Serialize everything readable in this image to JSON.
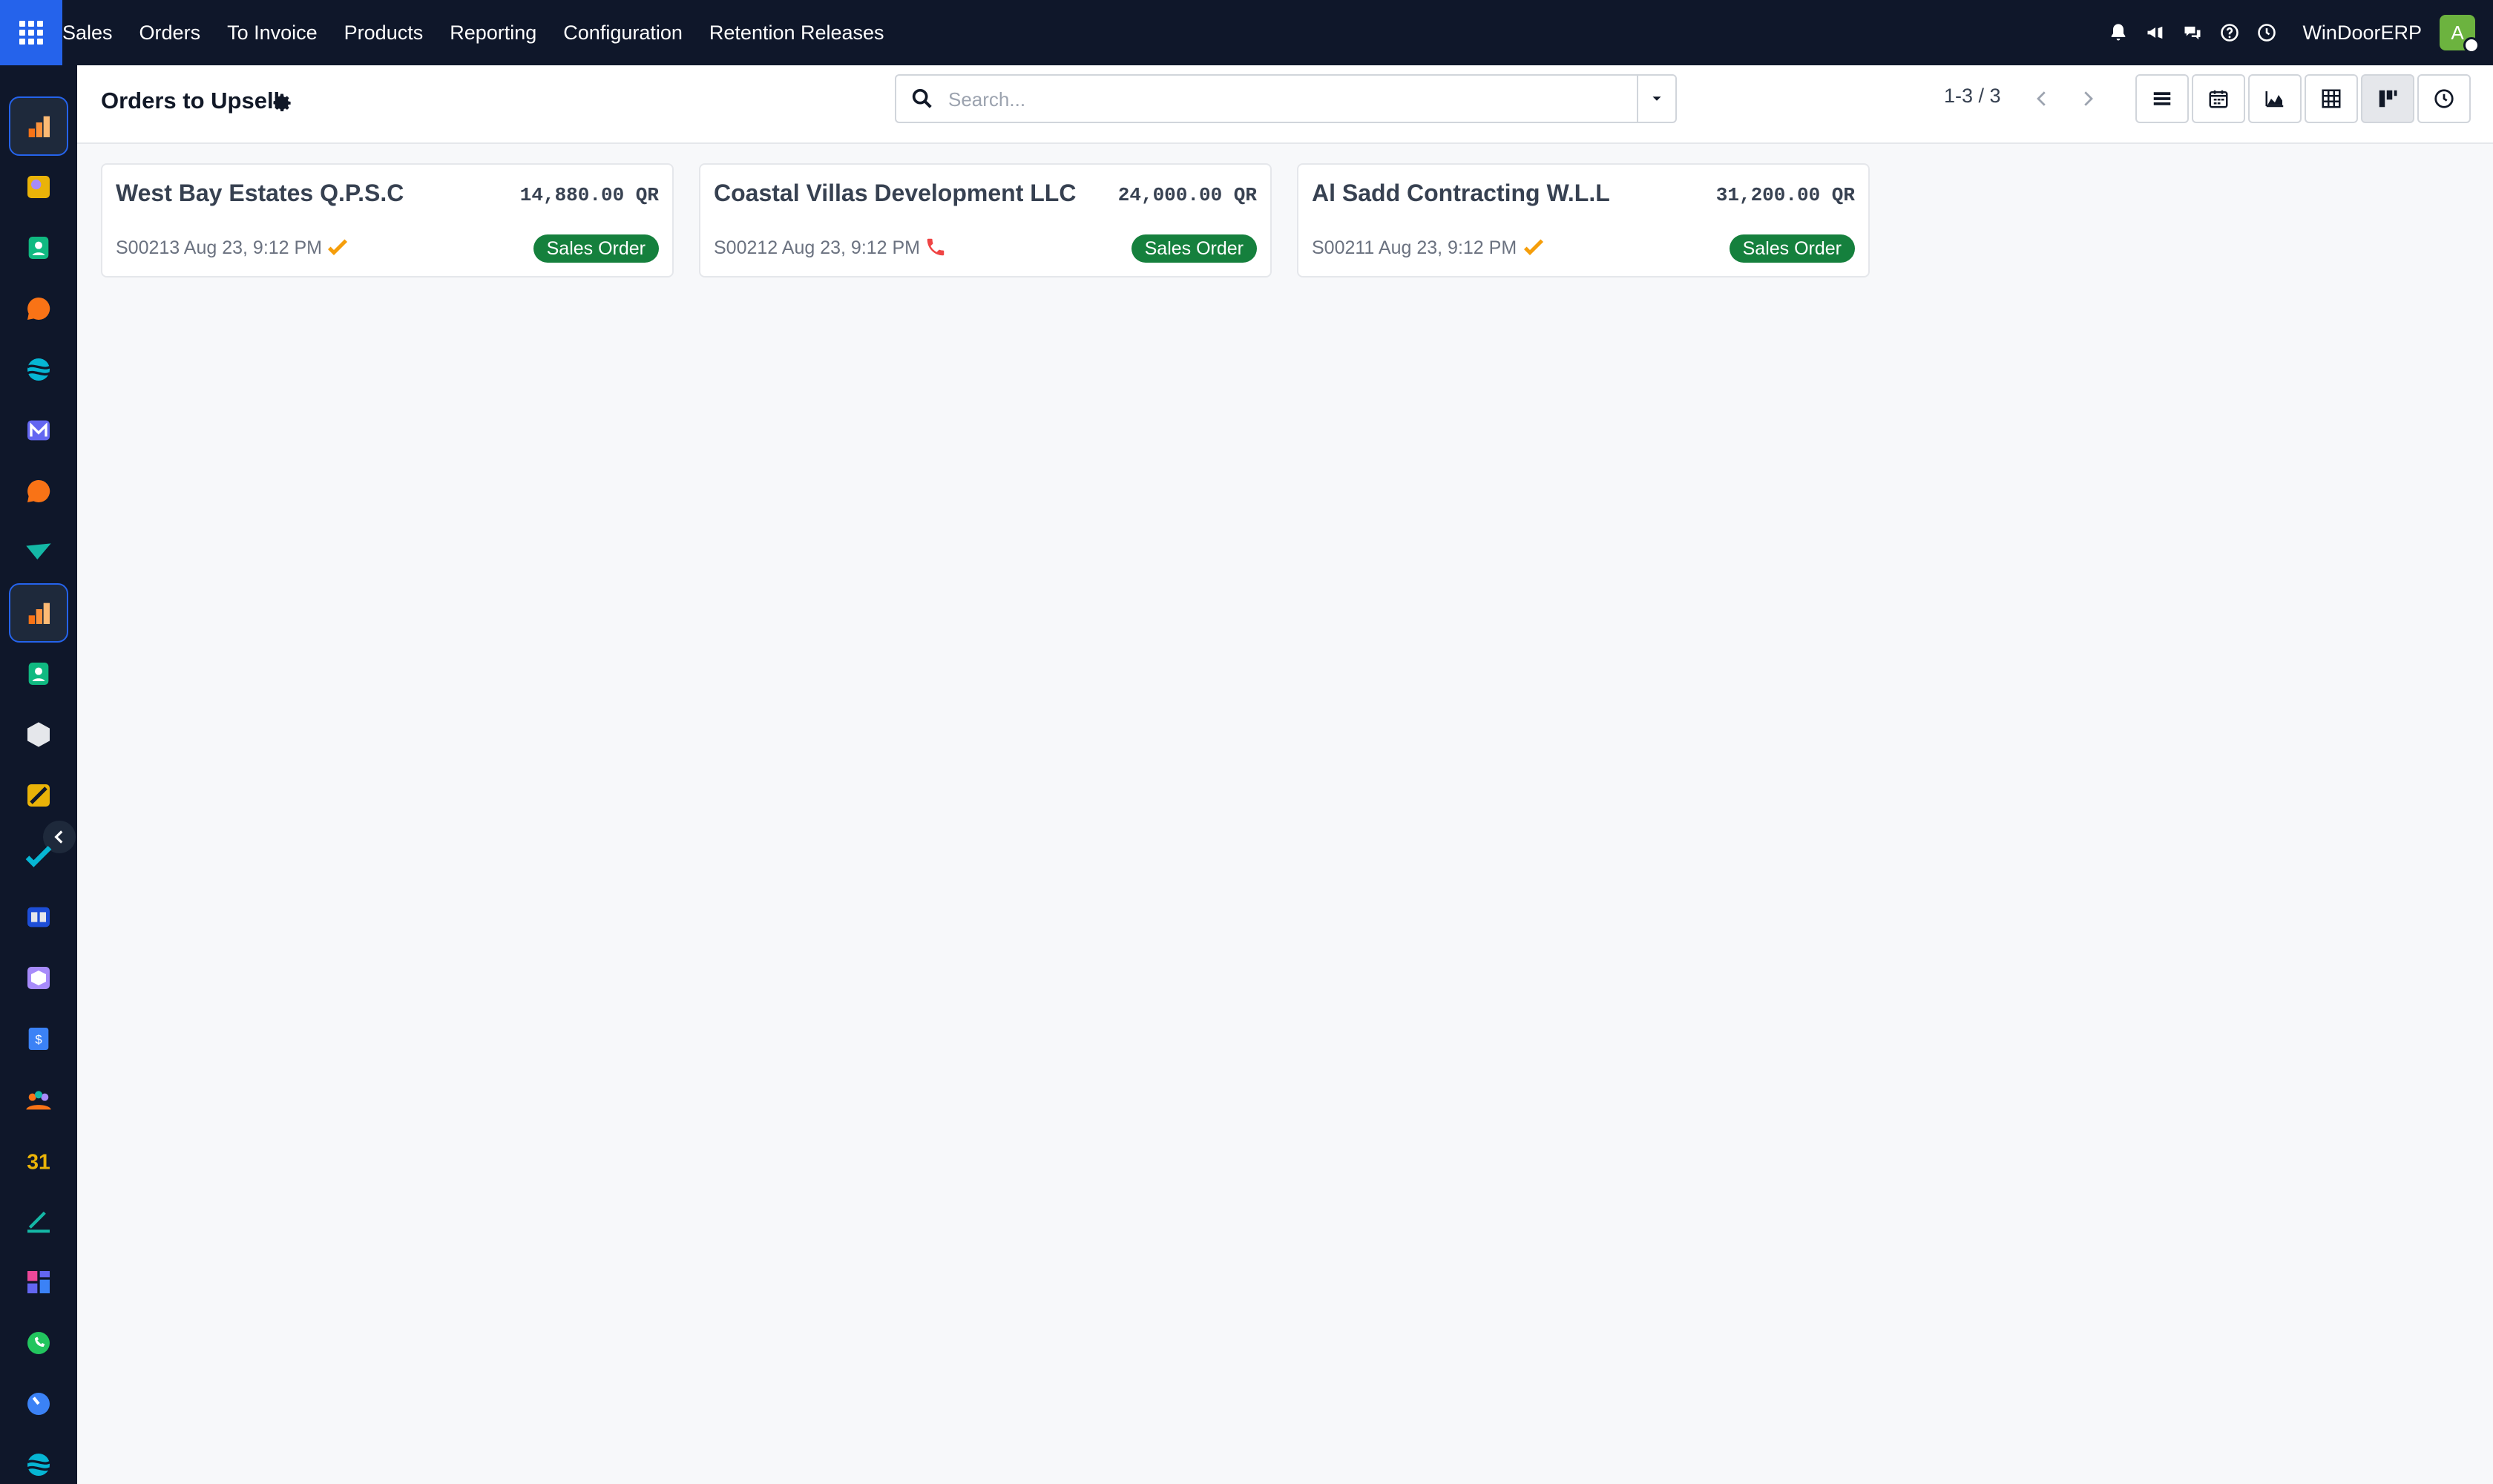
{
  "navbar": {
    "app_name": "Sales",
    "menu_items": [
      "Orders",
      "To Invoice",
      "Products",
      "Reporting",
      "Configuration",
      "Retention Releases"
    ],
    "company": "WinDoorERP",
    "avatar_initial": "A"
  },
  "sidebar": {
    "apps": [
      {
        "icon": "sales-chart-icon",
        "color": "#f97316",
        "active": true
      },
      {
        "icon": "palette-icon",
        "color": "#eab308"
      },
      {
        "icon": "contacts-icon",
        "color": "#10b981"
      },
      {
        "icon": "discuss-icon",
        "color": "#f97316"
      },
      {
        "icon": "website-icon",
        "color": "#06b6d4"
      },
      {
        "icon": "email-marketing-icon",
        "color": "#6366f1"
      },
      {
        "icon": "livechat-icon",
        "color": "#f97316"
      },
      {
        "icon": "crm-icon",
        "color": "#14b8a6"
      },
      {
        "icon": "sales-chart-icon",
        "color": "#f97316",
        "active": true
      },
      {
        "icon": "employees-icon",
        "color": "#10b981"
      },
      {
        "icon": "inventory-icon",
        "color": "#e5e7eb"
      },
      {
        "icon": "studio-icon",
        "color": "#eab308"
      },
      {
        "icon": "project-icon",
        "color": "#06b6d4"
      },
      {
        "icon": "knowledge-icon",
        "color": "#e5e7eb"
      },
      {
        "icon": "purchase-icon",
        "color": "#a78bfa"
      },
      {
        "icon": "invoicing-icon",
        "color": "#3b82f6"
      },
      {
        "icon": "team-icon",
        "color": "#f97316"
      },
      {
        "icon": "calendar-icon",
        "color": "#eab308"
      },
      {
        "icon": "sign-icon",
        "color": "#14b8a6"
      },
      {
        "icon": "dashboard-icon",
        "color": "#ec4899"
      },
      {
        "icon": "whatsapp-icon",
        "color": "#22c55e"
      },
      {
        "icon": "timer-icon",
        "color": "#3b82f6"
      },
      {
        "icon": "website-icon",
        "color": "#06b6d4"
      }
    ]
  },
  "control_panel": {
    "title": "Orders to Upsell",
    "search_placeholder": "Search...",
    "pager": "1-3 / 3"
  },
  "cards": [
    {
      "partner": "West Bay Estates Q.P.S.C",
      "amount": "14,880.00 QR",
      "reference": "S00213",
      "date": "Aug 23, 9:12 PM",
      "activity": "check-icon",
      "status": "Sales Order"
    },
    {
      "partner": "Coastal Villas Development LLC",
      "amount": "24,000.00 QR",
      "reference": "S00212",
      "date": "Aug 23, 9:12 PM",
      "activity": "phone-icon",
      "status": "Sales Order"
    },
    {
      "partner": "Al Sadd Contracting W.L.L",
      "amount": "31,200.00 QR",
      "reference": "S00211",
      "date": "Aug 23, 9:12 PM",
      "activity": "check-icon",
      "status": "Sales Order"
    }
  ],
  "colors": {
    "navbar_bg": "#0f172a",
    "apps_button": "#2563eb",
    "status_badge": "#15803d",
    "activity_check": "#f59e0b",
    "activity_phone": "#ef4444"
  }
}
